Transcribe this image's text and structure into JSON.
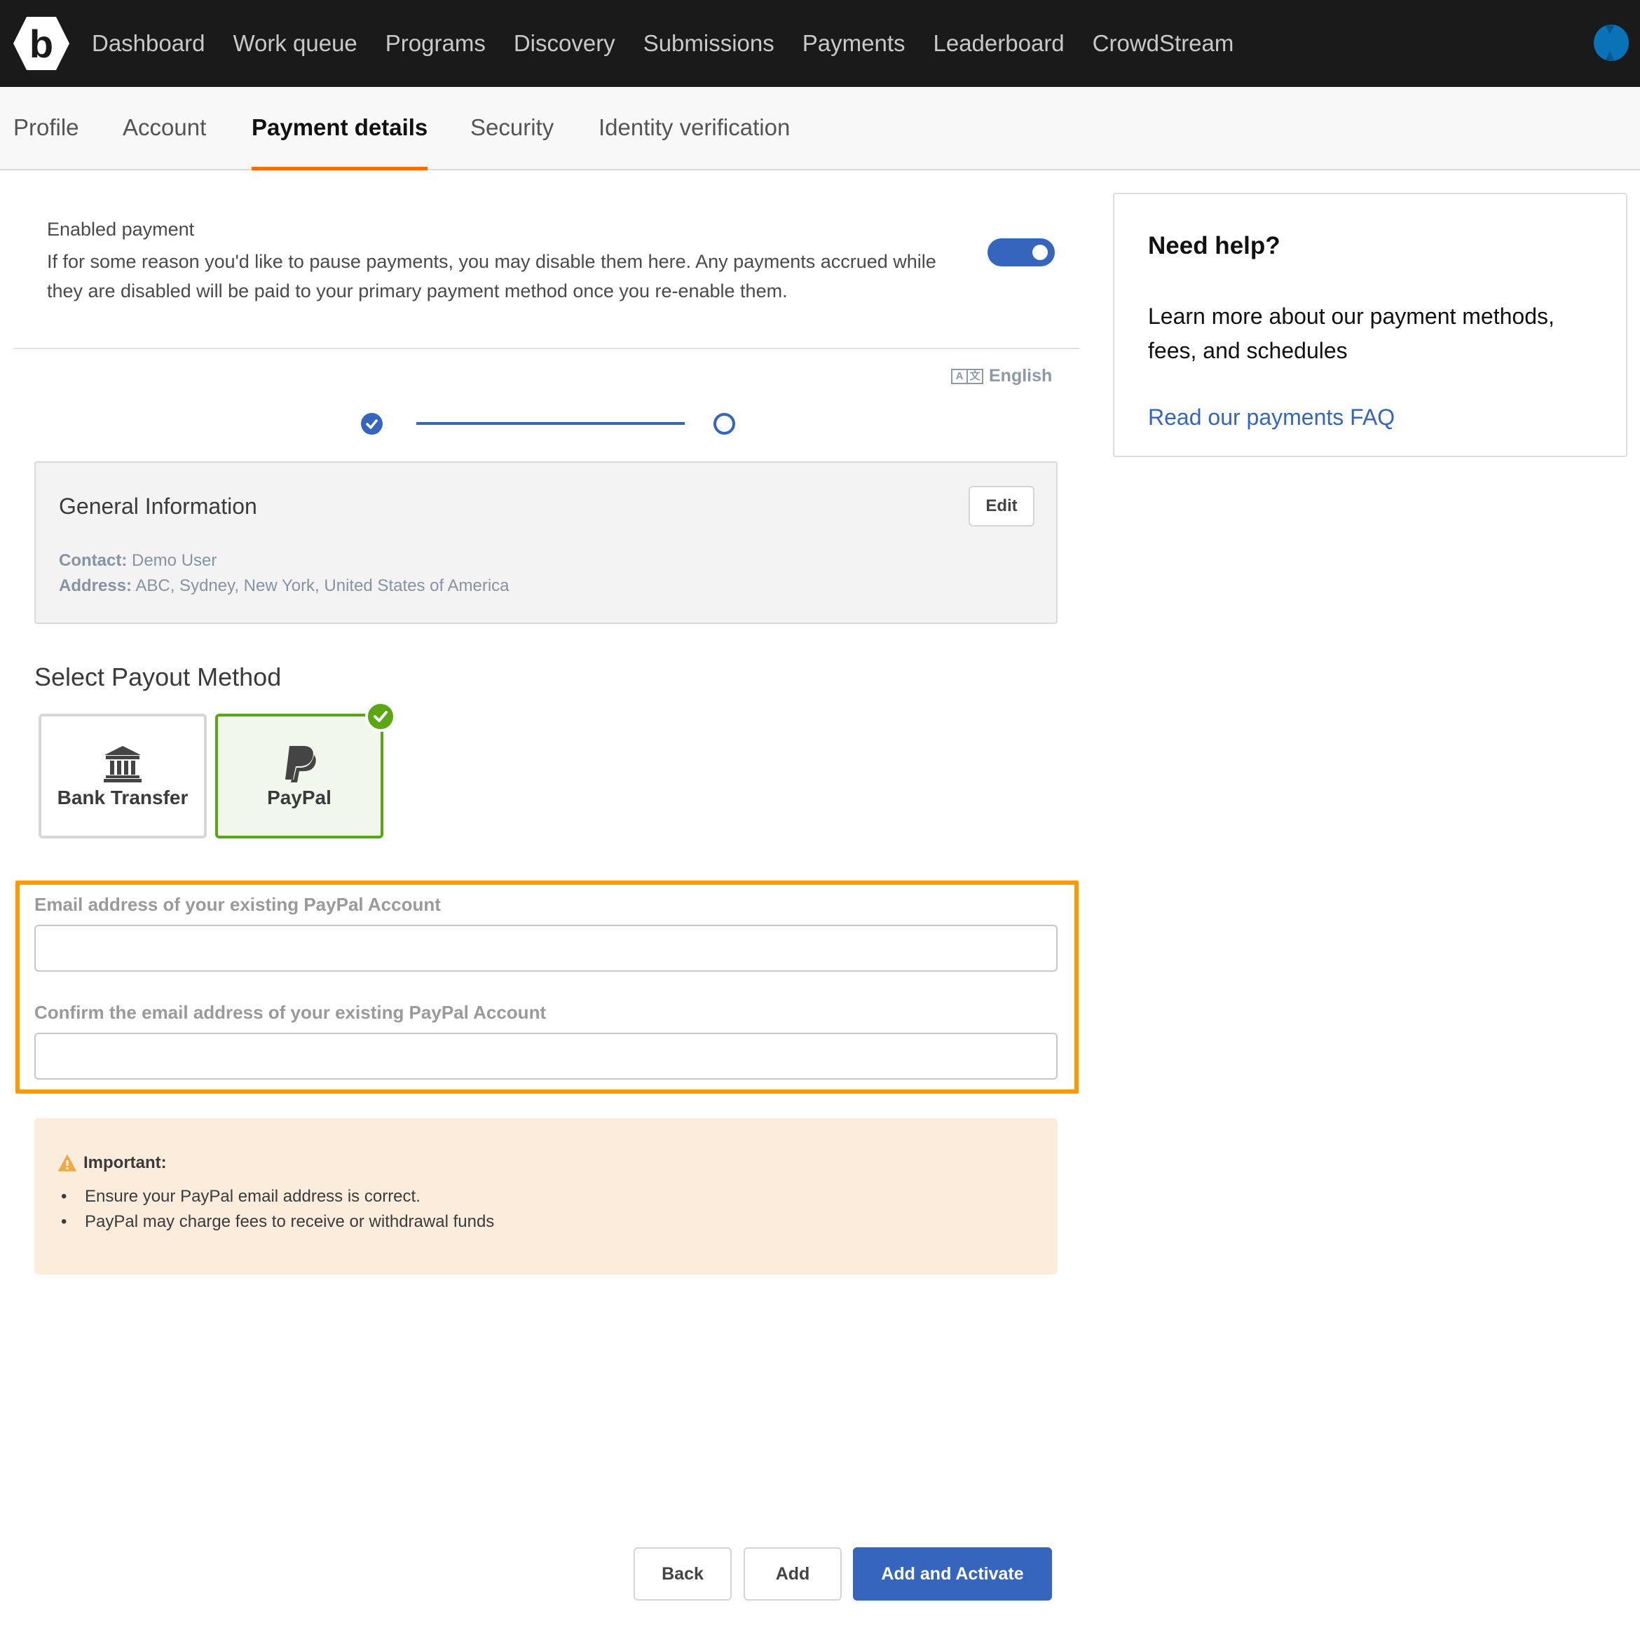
{
  "topnav": {
    "logo_letter": "b",
    "items": [
      "Dashboard",
      "Work queue",
      "Programs",
      "Discovery",
      "Submissions",
      "Payments",
      "Leaderboard",
      "CrowdStream"
    ]
  },
  "subtabs": {
    "items": [
      "Profile",
      "Account",
      "Payment details",
      "Security",
      "Identity verification"
    ],
    "active": "Payment details"
  },
  "enabled_payment": {
    "title": "Enabled payment",
    "description": "If for some reason you'd like to pause payments, you may disable them here. Any payments accrued while they are disabled will be paid to your primary payment method once you re-enable them.",
    "enabled": true
  },
  "language": {
    "icon_left": "A",
    "icon_right": "文",
    "label": "English"
  },
  "stepper": {
    "steps_total": 2,
    "current_step": 2,
    "completed_steps": 1
  },
  "general_info": {
    "title": "General Information",
    "edit_label": "Edit",
    "contact_label": "Contact:",
    "contact_value": "Demo User",
    "address_label": "Address:",
    "address_value": "ABC, Sydney, New York, United States of America"
  },
  "payout": {
    "heading": "Select Payout Method",
    "methods": [
      {
        "label": "Bank Transfer",
        "icon": "bank-icon",
        "selected": false
      },
      {
        "label": "PayPal",
        "icon": "paypal-icon",
        "selected": true
      }
    ]
  },
  "paypal_form": {
    "email_label": "Email address of your existing PayPal Account",
    "email_value": "",
    "confirm_label": "Confirm the email address of your existing PayPal Account",
    "confirm_value": ""
  },
  "important": {
    "title": "Important:",
    "items": [
      "Ensure your PayPal email address is correct.",
      "PayPal may charge fees to receive or withdrawal funds"
    ]
  },
  "actions": {
    "back_label": "Back",
    "add_label": "Add",
    "add_activate_label": "Add and Activate"
  },
  "help": {
    "title": "Need help?",
    "text": "Learn more about our payment methods, fees, and schedules",
    "link": "Read our payments FAQ"
  },
  "colors": {
    "accent_blue": "#3565bd",
    "tab_underline": "#ff6b00",
    "highlight_orange": "#ff9900",
    "selected_green": "#5aa713",
    "warning_bg": "#fcecdc"
  }
}
